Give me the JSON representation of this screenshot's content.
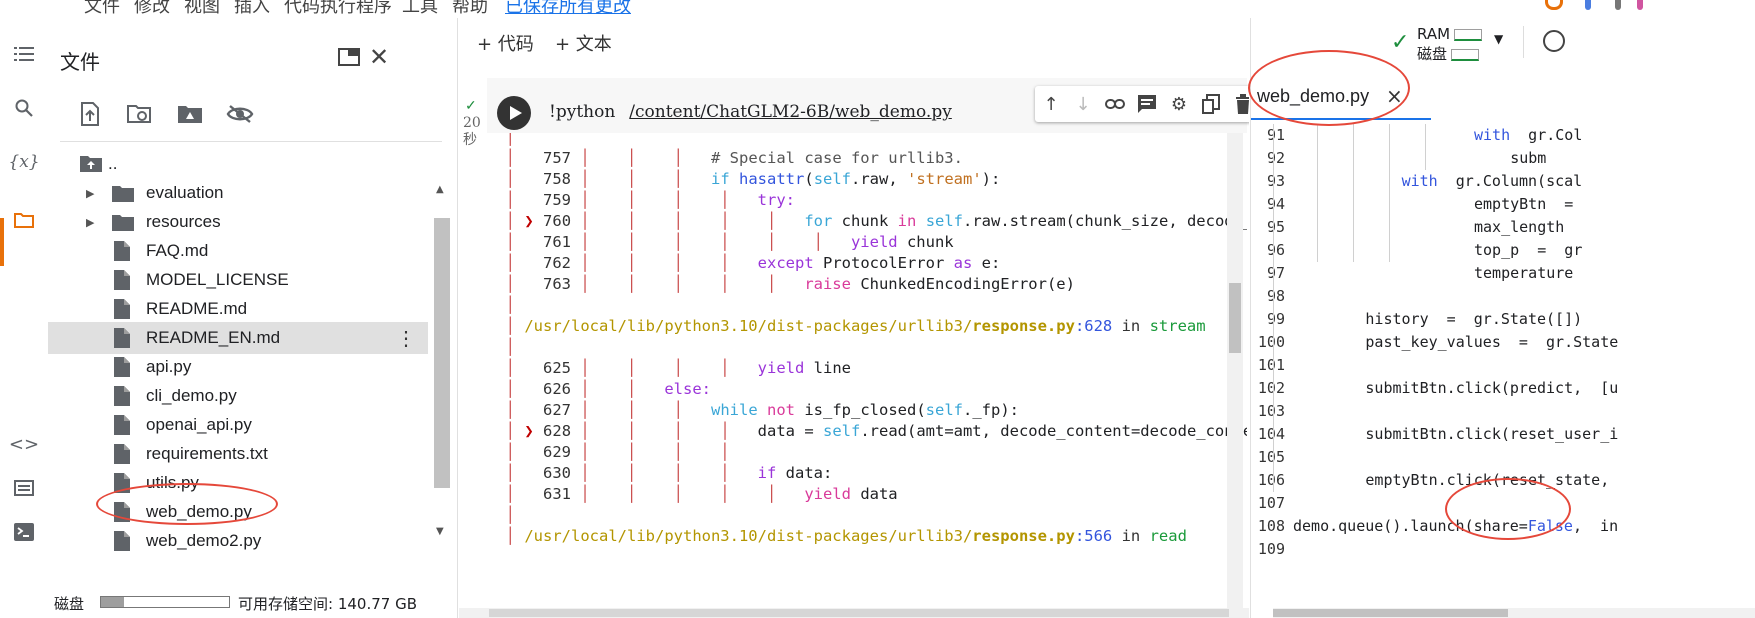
{
  "menubar": {
    "items": [
      "文件",
      "修改",
      "视图",
      "插入",
      "代码执行程序",
      "工具",
      "帮助"
    ],
    "save_link": "已保存所有更改"
  },
  "files_panel": {
    "title": "文件",
    "parent_dir": "..",
    "items": [
      {
        "name": "evaluation",
        "type": "folder"
      },
      {
        "name": "resources",
        "type": "folder"
      },
      {
        "name": "FAQ.md",
        "type": "file"
      },
      {
        "name": "MODEL_LICENSE",
        "type": "file"
      },
      {
        "name": "README.md",
        "type": "file"
      },
      {
        "name": "README_EN.md",
        "type": "file",
        "selected": true
      },
      {
        "name": "api.py",
        "type": "file"
      },
      {
        "name": "cli_demo.py",
        "type": "file"
      },
      {
        "name": "openai_api.py",
        "type": "file"
      },
      {
        "name": "requirements.txt",
        "type": "file"
      },
      {
        "name": "utils.py",
        "type": "file"
      },
      {
        "name": "web_demo.py",
        "type": "file"
      },
      {
        "name": "web_demo2.py",
        "type": "file"
      }
    ],
    "disk_label": "磁盘",
    "disk_free": "可用存储空间: 140.77 GB",
    "disk_used_fraction": 0.18
  },
  "notebook": {
    "add_code": "+ 代码",
    "add_text": "+ 文本",
    "cell_exec_check": "✓",
    "cell_exec_time": "20",
    "cell_exec_unit": "秒",
    "command": "!python",
    "command_path": "/content/ChatGLM2-6B/web_demo.py"
  },
  "output_lines": [
    {
      "num": "757",
      "depth": 3,
      "code": "# Special case for urllib3.",
      "style": "cmt"
    },
    {
      "num": "758",
      "depth": 3,
      "code": "if hasattr(self.raw, 'stream'):",
      "style": "mix758"
    },
    {
      "num": "759",
      "depth": 4,
      "code": "try:",
      "style": "kw"
    },
    {
      "num": "760",
      "depth": 5,
      "code": "for chunk in self.raw.stream(chunk_size, decode_co",
      "style": "mix760",
      "mark": true
    },
    {
      "num": "761",
      "depth": 6,
      "code": "yield chunk",
      "style": "mix761"
    },
    {
      "num": "762",
      "depth": 4,
      "code": "except ProtocolError as e:",
      "style": "mix762"
    },
    {
      "num": "763",
      "depth": 5,
      "code": "raise ChunkedEncodingError(e)",
      "style": "mix763"
    }
  ],
  "trace_path_1": {
    "prefix": "/usr/local/lib/python3.10/dist-packages/urllib3/",
    "file": "response.py",
    "line": ":628",
    "in": " in ",
    "func": "stream"
  },
  "output_lines_2": [
    {
      "num": "625",
      "depth": 4,
      "code": "yield line",
      "style": "mix625"
    },
    {
      "num": "626",
      "depth": 2,
      "code": "else:",
      "style": "kw"
    },
    {
      "num": "627",
      "depth": 3,
      "code": "while not is_fp_closed(self._fp):",
      "style": "mix627"
    },
    {
      "num": "628",
      "depth": 4,
      "code": "data = self.read(amt=amt, decode_content=decode_conten",
      "style": "mix628",
      "mark": true
    },
    {
      "num": "629",
      "depth": 4,
      "code": "",
      "style": "code"
    },
    {
      "num": "630",
      "depth": 4,
      "code": "if data:",
      "style": "mix630"
    },
    {
      "num": "631",
      "depth": 5,
      "code": "yield data",
      "style": "mix631"
    }
  ],
  "trace_path_2": {
    "prefix": "/usr/local/lib/python3.10/dist-packages/urllib3/",
    "file": "response.py",
    "line": ":566",
    "in": " in ",
    "func": "read"
  },
  "right_panel": {
    "ram_label": "RAM",
    "disk_label": "磁盘",
    "tab_name": "web_demo.py",
    "tab_close": "×"
  },
  "editor_lines": [
    {
      "n": "91",
      "indent": 20,
      "text": "with  gr.Col"
    },
    {
      "n": "92",
      "indent": 24,
      "text": "subm"
    },
    {
      "n": "93",
      "indent": 12,
      "text": "with  gr.Column(scal"
    },
    {
      "n": "94",
      "indent": 20,
      "text": "emptyBtn  ="
    },
    {
      "n": "95",
      "indent": 20,
      "text": "max_length"
    },
    {
      "n": "96",
      "indent": 20,
      "text": "top_p  =  gr"
    },
    {
      "n": "97",
      "indent": 20,
      "text": "temperature"
    },
    {
      "n": "98",
      "indent": 0,
      "text": ""
    },
    {
      "n": "99",
      "indent": 8,
      "text": "history  =  gr.State([])"
    },
    {
      "n": "100",
      "indent": 8,
      "text": "past_key_values  =  gr.State"
    },
    {
      "n": "101",
      "indent": 0,
      "text": ""
    },
    {
      "n": "102",
      "indent": 8,
      "text": "submitBtn.click(predict,  [u"
    },
    {
      "n": "103",
      "indent": 0,
      "text": ""
    },
    {
      "n": "104",
      "indent": 8,
      "text": "submitBtn.click(reset_user_i"
    },
    {
      "n": "105",
      "indent": 0,
      "text": ""
    },
    {
      "n": "106",
      "indent": 8,
      "text": "emptyBtn.click(reset_state,"
    },
    {
      "n": "107",
      "indent": 0,
      "text": ""
    },
    {
      "n": "108",
      "indent": 0,
      "text": "demo.queue().launch(share=False,  in"
    },
    {
      "n": "109",
      "indent": 0,
      "text": ""
    }
  ],
  "colors": {
    "accent_orange": "#e8710a",
    "annotation_red": "#e5483a",
    "check_green": "#1e8e3e"
  }
}
